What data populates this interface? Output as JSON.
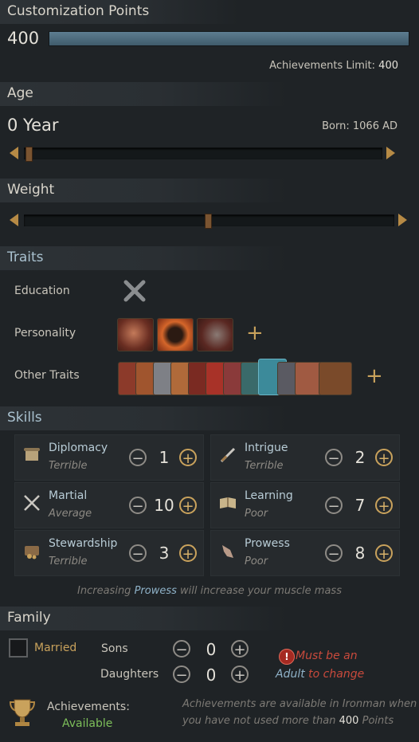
{
  "customization": {
    "title": "Customization Points",
    "points": "400",
    "limit_label": "Achievements Limit:",
    "limit_value": "400"
  },
  "age": {
    "title": "Age",
    "value": "0 Year",
    "born_label": "Born:",
    "born_value": "1066 AD",
    "slider_level": 0.02
  },
  "weight": {
    "title": "Weight",
    "slider_level": 0.49
  },
  "traits": {
    "title": "Traits",
    "education_label": "Education",
    "personality_label": "Personality",
    "other_label": "Other Traits",
    "personality_count": 3,
    "other_count": 11
  },
  "skills": {
    "title": "Skills",
    "items": [
      {
        "name": "Diplomacy",
        "level": "Terrible",
        "value": "1",
        "icon": "scroll-icon"
      },
      {
        "name": "Intrigue",
        "level": "Terrible",
        "value": "2",
        "icon": "dagger-icon"
      },
      {
        "name": "Martial",
        "level": "Average",
        "value": "10",
        "icon": "crossed-swords-icon"
      },
      {
        "name": "Learning",
        "level": "Poor",
        "value": "7",
        "icon": "book-icon"
      },
      {
        "name": "Stewardship",
        "level": "Terrible",
        "value": "3",
        "icon": "coin-chest-icon"
      },
      {
        "name": "Prowess",
        "level": "Poor",
        "value": "8",
        "icon": "fist-icon"
      }
    ],
    "hint_pre": "Increasing",
    "hint_key": "Prowess",
    "hint_post": "will increase your muscle mass"
  },
  "family": {
    "title": "Family",
    "married_label": "Married",
    "sons_label": "Sons",
    "sons_value": "0",
    "daughters_label": "Daughters",
    "daughters_value": "0",
    "warning_line1": "Must be an",
    "warning_adult": "Adult",
    "warning_line2": "to change"
  },
  "achievements": {
    "label": "Achievements:",
    "status": "Available",
    "note_line1": "Achievements are available in Ironman when",
    "note_pre": "you have not used more than",
    "note_value": "400",
    "note_post": "Points"
  },
  "colors": {
    "accent_gold": "#c9a25c",
    "skill_name": "#b8ccd6",
    "available_green": "#7dbf5a",
    "warning_red": "#c94a3c"
  }
}
